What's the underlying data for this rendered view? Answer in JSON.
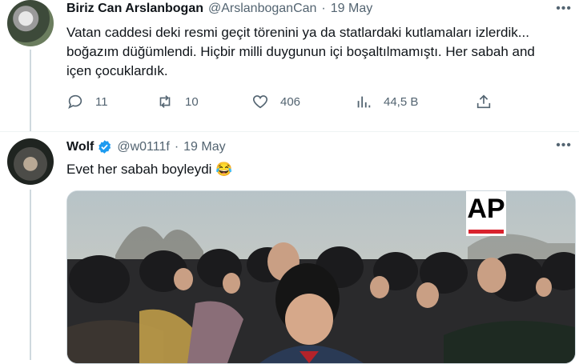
{
  "tweet1": {
    "name": "Biriz Can Arslanbogan",
    "handle": "@ArslanboganCan",
    "dot": "·",
    "date": "19 May",
    "text": "Vatan caddesi deki resmi geçit törenini ya da statlardaki kutlamaları izlerdik... boğazım düğümlendi. Hiçbir milli duygunun içi boşaltılmamıştı. Her sabah and içen çocuklardık.",
    "actions": {
      "reply": "11",
      "retweet": "10",
      "like": "406",
      "views": "44,5 B"
    }
  },
  "tweet2": {
    "name": "Wolf",
    "handle": "@w0111f",
    "dot": "·",
    "date": "19 May",
    "text": "Evet her sabah boyleydi 😂",
    "media_watermark": "AP"
  },
  "colors": {
    "secondary": "#536471",
    "verified": "#1d9bf0",
    "ap_red": "#d9232e"
  }
}
